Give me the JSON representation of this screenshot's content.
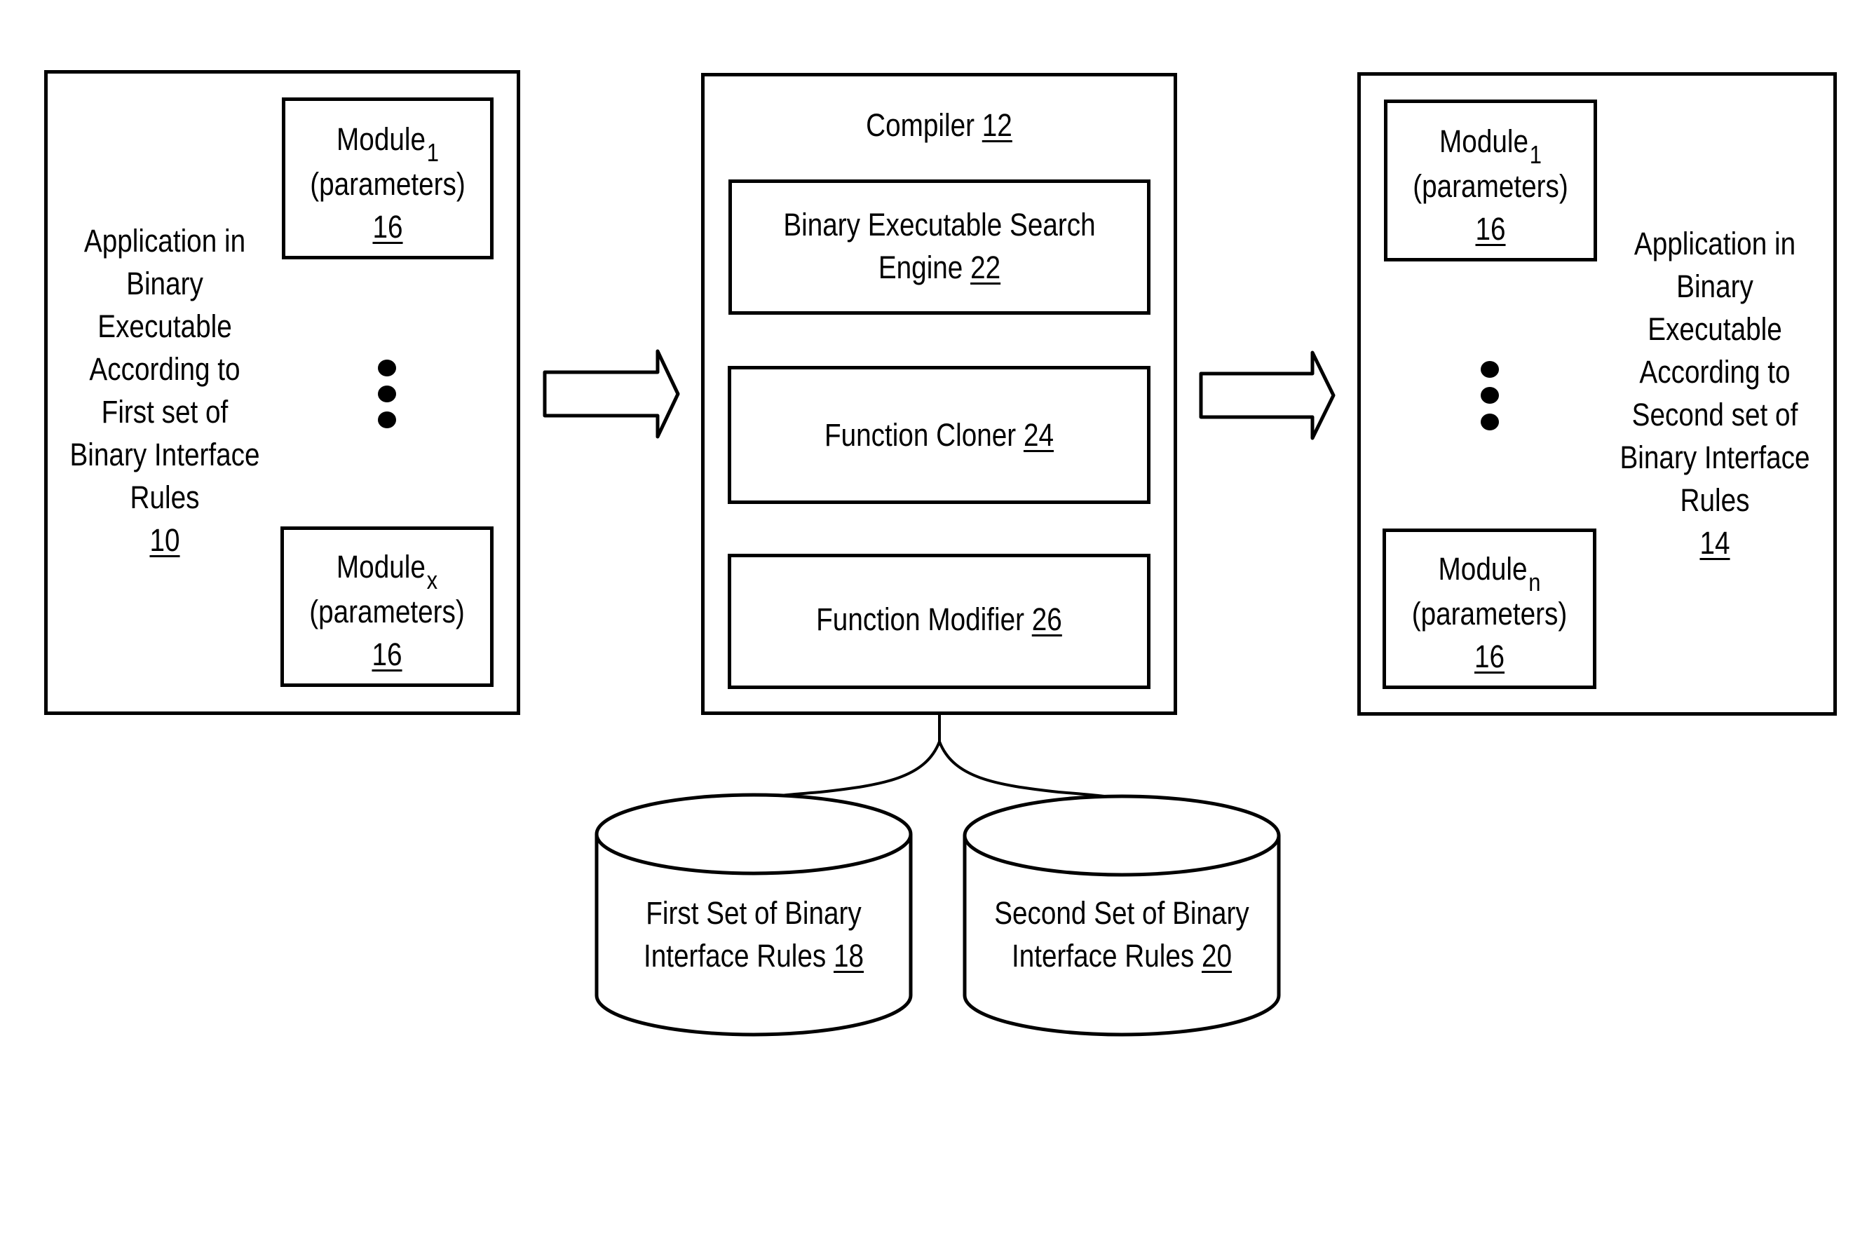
{
  "left_app": {
    "lines": [
      "Application in",
      "Binary",
      "Executable",
      "According to",
      "First set of",
      "Binary Interface",
      "Rules"
    ],
    "ref": "10",
    "modules": [
      {
        "name": "Module",
        "sub": "1",
        "params": "(parameters)",
        "ref": "16"
      },
      {
        "name": "Module",
        "sub": "x",
        "params": "(parameters)",
        "ref": "16"
      }
    ]
  },
  "compiler": {
    "title": "Compiler",
    "ref": "12",
    "components": [
      {
        "lines": [
          "Binary Executable Search",
          "Engine"
        ],
        "ref": "22"
      },
      {
        "lines": [
          "Function Cloner"
        ],
        "ref": "24"
      },
      {
        "lines": [
          "Function Modifier"
        ],
        "ref": "26"
      }
    ]
  },
  "right_app": {
    "lines": [
      "Application in",
      "Binary",
      "Executable",
      "According to",
      "Second set of",
      "Binary Interface",
      "Rules"
    ],
    "ref": "14",
    "modules": [
      {
        "name": "Module",
        "sub": "1",
        "params": "(parameters)",
        "ref": "16"
      },
      {
        "name": "Module",
        "sub": "n",
        "params": "(parameters)",
        "ref": "16"
      }
    ]
  },
  "databases": [
    {
      "lines": [
        "First Set of Binary",
        "Interface Rules"
      ],
      "ref": "18"
    },
    {
      "lines": [
        "Second Set of Binary",
        "Interface Rules"
      ],
      "ref": "20"
    }
  ],
  "arrows": [
    "flow-arrow-right",
    "flow-arrow-right"
  ]
}
